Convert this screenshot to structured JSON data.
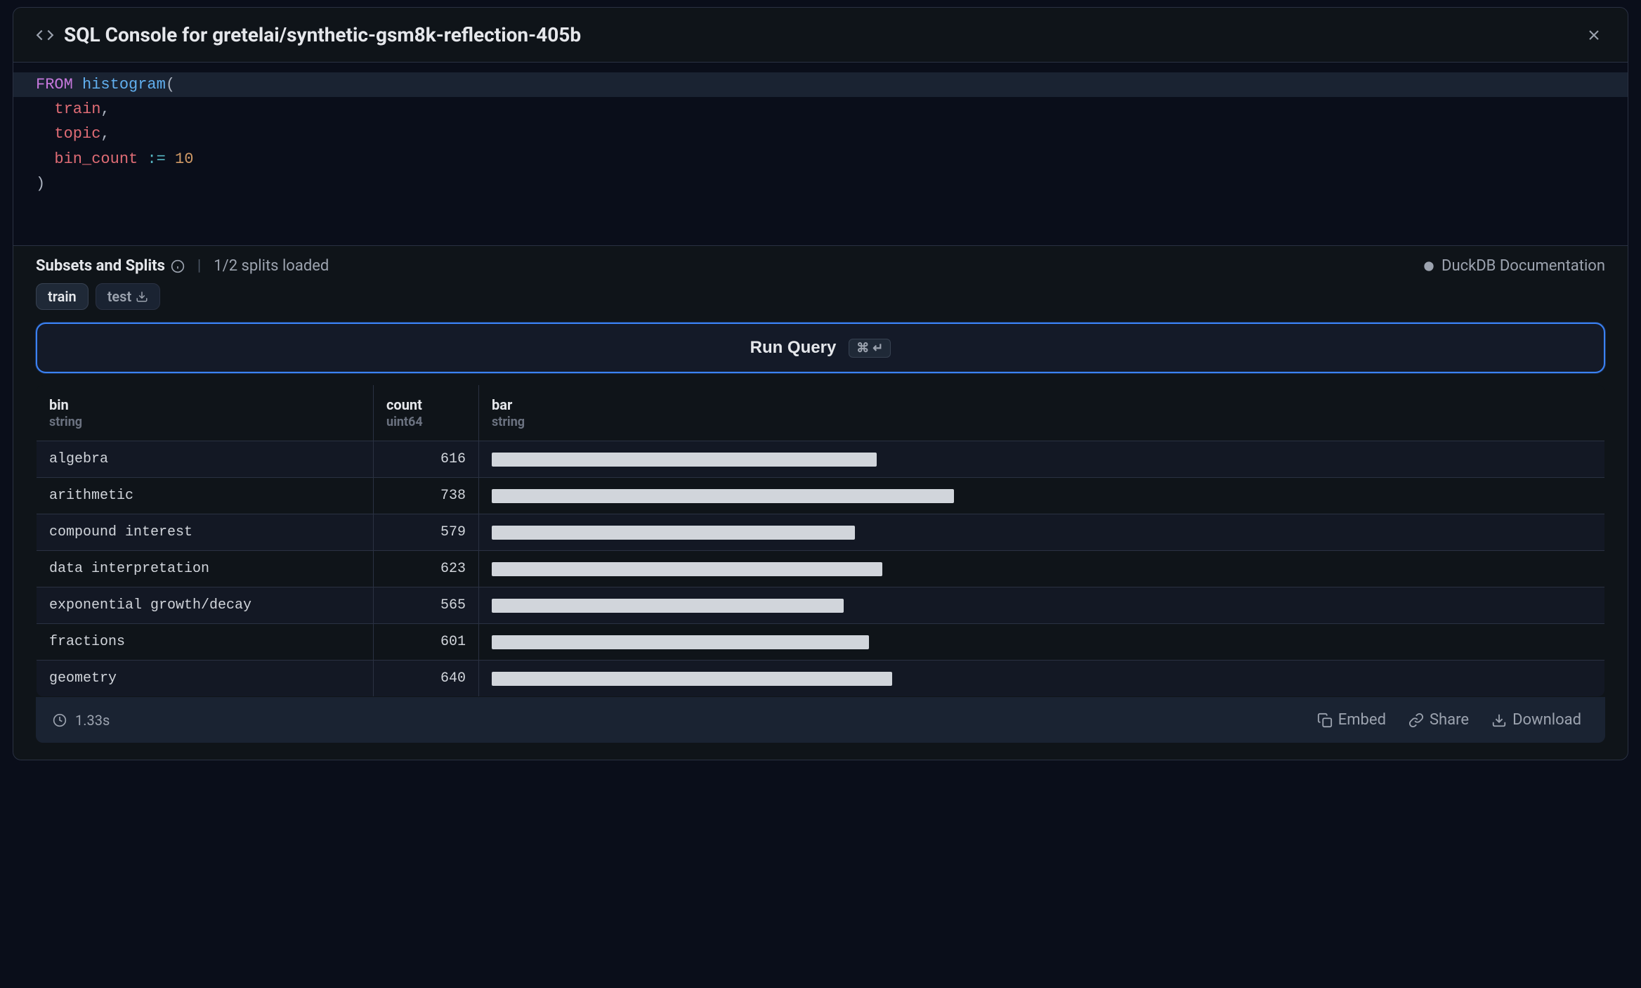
{
  "header": {
    "title": "SQL Console for gretelai/synthetic-gsm8k-reflection-405b"
  },
  "code": {
    "tokens": [
      {
        "line": 0,
        "text": "FROM",
        "cls": "kw",
        "hl": true
      },
      {
        "line": 0,
        "text": " ",
        "cls": "",
        "hl": true
      },
      {
        "line": 0,
        "text": "histogram",
        "cls": "fn",
        "hl": true
      },
      {
        "line": 0,
        "text": "(",
        "cls": "paren",
        "hl": true
      },
      {
        "line": 1,
        "text": "  train",
        "cls": "param"
      },
      {
        "line": 1,
        "text": ",",
        "cls": "comma"
      },
      {
        "line": 2,
        "text": "  topic",
        "cls": "param"
      },
      {
        "line": 2,
        "text": ",",
        "cls": "comma"
      },
      {
        "line": 3,
        "text": "  bin_count",
        "cls": "param"
      },
      {
        "line": 3,
        "text": " ",
        "cls": ""
      },
      {
        "line": 3,
        "text": ":=",
        "cls": "op"
      },
      {
        "line": 3,
        "text": " ",
        "cls": ""
      },
      {
        "line": 3,
        "text": "10",
        "cls": "num"
      },
      {
        "line": 4,
        "text": ")",
        "cls": "paren"
      }
    ]
  },
  "splits": {
    "title": "Subsets and Splits",
    "status": "1/2 splits loaded",
    "docs_label": "DuckDB Documentation",
    "chips": [
      {
        "label": "train",
        "active": true
      },
      {
        "label": "test",
        "active": false,
        "download": true
      }
    ]
  },
  "run_query": {
    "label": "Run Query",
    "shortcut": "⌘ ↵"
  },
  "results": {
    "columns": [
      {
        "name": "bin",
        "type": "string"
      },
      {
        "name": "count",
        "type": "uint64"
      },
      {
        "name": "bar",
        "type": "string"
      }
    ],
    "rows": [
      {
        "bin": "algebra",
        "count": "616",
        "bar_pct": 35
      },
      {
        "bin": "arithmetic",
        "count": "738",
        "bar_pct": 42
      },
      {
        "bin": "compound interest",
        "count": "579",
        "bar_pct": 33
      },
      {
        "bin": "data interpretation",
        "count": "623",
        "bar_pct": 35.5
      },
      {
        "bin": "exponential growth/decay",
        "count": "565",
        "bar_pct": 32
      },
      {
        "bin": "fractions",
        "count": "601",
        "bar_pct": 34.3
      },
      {
        "bin": "geometry",
        "count": "640",
        "bar_pct": 36.4
      }
    ]
  },
  "footer": {
    "exec_time": "1.33s",
    "embed_label": "Embed",
    "share_label": "Share",
    "download_label": "Download"
  },
  "chart_data": {
    "type": "bar",
    "categories": [
      "algebra",
      "arithmetic",
      "compound interest",
      "data interpretation",
      "exponential growth/decay",
      "fractions",
      "geometry"
    ],
    "values": [
      616,
      738,
      579,
      623,
      565,
      601,
      640
    ],
    "title": "histogram(train, topic)",
    "xlabel": "count",
    "ylabel": "bin"
  }
}
